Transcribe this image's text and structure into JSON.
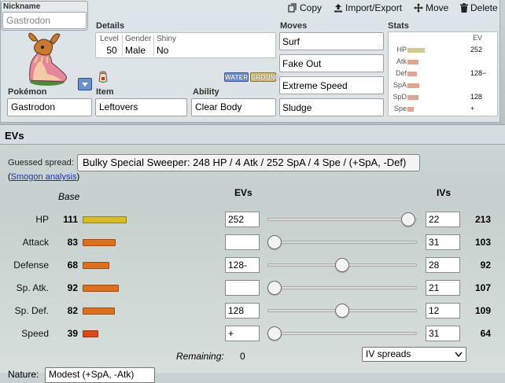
{
  "toolbar": {
    "copy_label": "Copy",
    "import_export_label": "Import/Export",
    "move_label": "Move",
    "delete_label": "Delete"
  },
  "nickname": {
    "label": "Nickname",
    "placeholder": "Gastrodon"
  },
  "details": {
    "title": "Details",
    "level_label": "Level",
    "level": "50",
    "gender_label": "Gender",
    "gender": "Male",
    "shiny_label": "Shiny",
    "shiny": "No"
  },
  "types": [
    "WATER",
    "GROUND"
  ],
  "type_colors": {
    "WATER": "#6890f0",
    "GROUND": "#e0c068"
  },
  "fields": {
    "pokemon_label": "Pokémon",
    "pokemon": "Gastrodon",
    "item_label": "Item",
    "item": "Leftovers",
    "ability_label": "Ability",
    "ability": "Clear Body"
  },
  "moves": {
    "title": "Moves",
    "list": [
      "Surf",
      "Fake Out",
      "Extreme Speed",
      "Sludge"
    ]
  },
  "stats_panel": {
    "title": "Stats",
    "ev_header": "EV",
    "rows": [
      {
        "name": "HP",
        "ev": "252",
        "fill": 0.55,
        "color": "#d4c98a"
      },
      {
        "name": "Atk",
        "ev": "",
        "fill": 0.36,
        "color": "#e3a48d"
      },
      {
        "name": "Def",
        "ev": "128−",
        "fill": 0.3,
        "color": "#e3a48d"
      },
      {
        "name": "SpA",
        "ev": "",
        "fill": 0.38,
        "color": "#e3a48d"
      },
      {
        "name": "SpD",
        "ev": "128",
        "fill": 0.36,
        "color": "#e3a48d"
      },
      {
        "name": "Spe",
        "ev": "+",
        "fill": 0.2,
        "color": "#e3a48d"
      }
    ]
  },
  "evs": {
    "header": "EVs",
    "guessed_label": "Guessed spread:",
    "guessed_value": "Bulky Special Sweeper: 248 HP / 4 Atk / 252 SpA / 4 Spe / (+SpA, -Def)",
    "smogon_open": "(",
    "smogon_link": "Smogon analysis",
    "smogon_close": ")",
    "base_header": "Base",
    "evs_header": "EVs",
    "ivs_header": "IVs",
    "rows": [
      {
        "name": "HP",
        "base": "111",
        "base_fraction": 0.436,
        "bar_color": "#d8bb24",
        "ev": "252",
        "ev_fraction": 0.99,
        "iv": "22",
        "total": "213"
      },
      {
        "name": "Attack",
        "base": "83",
        "base_fraction": 0.326,
        "bar_color": "#e06f1c",
        "ev": "",
        "ev_fraction": 0.0,
        "iv": "31",
        "total": "103"
      },
      {
        "name": "Defense",
        "base": "68",
        "base_fraction": 0.267,
        "bar_color": "#e06f1c",
        "ev": "128-",
        "ev_fraction": 0.5,
        "iv": "28",
        "total": "92"
      },
      {
        "name": "Sp. Atk.",
        "base": "92",
        "base_fraction": 0.361,
        "bar_color": "#e06f1c",
        "ev": "",
        "ev_fraction": 0.0,
        "iv": "21",
        "total": "107"
      },
      {
        "name": "Sp. Def.",
        "base": "82",
        "base_fraction": 0.322,
        "bar_color": "#e06f1c",
        "ev": "128",
        "ev_fraction": 0.5,
        "iv": "12",
        "total": "109"
      },
      {
        "name": "Speed",
        "base": "39",
        "base_fraction": 0.153,
        "bar_color": "#dd4a16",
        "ev": "+",
        "ev_fraction": 0.0,
        "iv": "31",
        "total": "64"
      }
    ],
    "remaining_label": "Remaining:",
    "remaining_value": "0",
    "iv_spreads_option": "IV spreads"
  },
  "nature": {
    "label": "Nature:",
    "value": "Modest (+SpA, -Atk)"
  }
}
